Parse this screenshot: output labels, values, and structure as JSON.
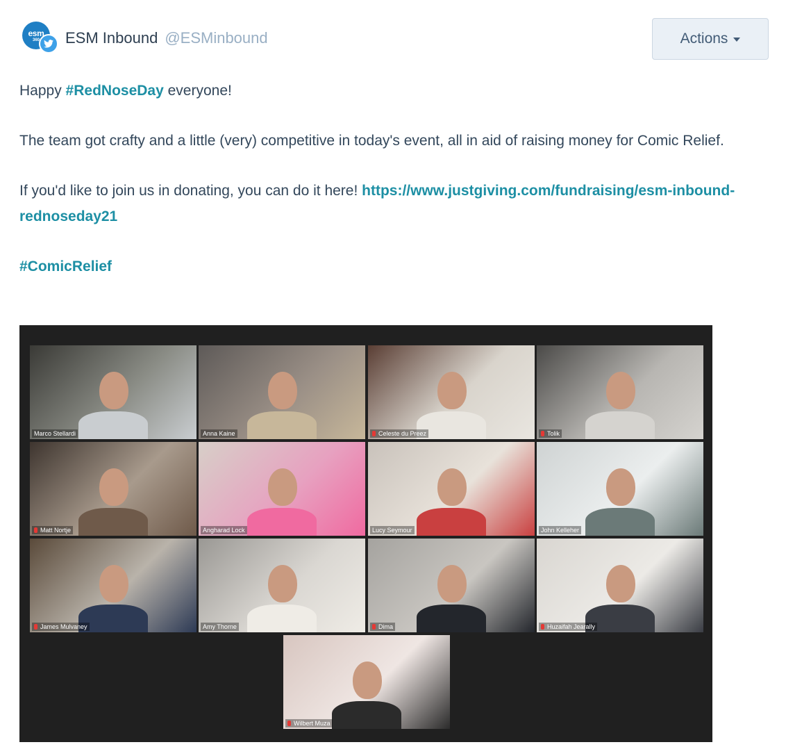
{
  "account": {
    "name": "ESM Inbound",
    "handle": "@ESMinbound",
    "avatar_text": "esm",
    "avatar_subtext": "360",
    "network_icon": "twitter-icon",
    "brand_color": "#1f7fc4",
    "twitter_color": "#3ea1e8"
  },
  "actions": {
    "label": "Actions"
  },
  "post": {
    "line1_prefix": "Happy ",
    "line1_hashtag": "#RedNoseDay",
    "line1_suffix": " everyone!",
    "paragraph2": "The team got crafty and a little (very) competitive in today's event, all in aid of raising money for Comic Relief.",
    "paragraph3_prefix": "If you'd like to join us in donating, you can do it here! ",
    "paragraph3_link": "https://www.justgiving.com/fundraising/esm-inbound-rednoseday21",
    "hashtag_footer": "#ComicRelief",
    "link_color": "#1d8fa4"
  },
  "video_call": {
    "participants": [
      {
        "name": "Marco Stellardi",
        "muted": false,
        "active": false
      },
      {
        "name": "Anna Kaine",
        "muted": false,
        "active": false
      },
      {
        "name": "Celeste du Preez",
        "muted": true,
        "active": false
      },
      {
        "name": "Tolik",
        "muted": true,
        "active": false
      },
      {
        "name": "Matt Nortje",
        "muted": true,
        "active": false
      },
      {
        "name": "Angharad Lock",
        "muted": false,
        "active": true
      },
      {
        "name": "Lucy Seymour",
        "muted": false,
        "active": false
      },
      {
        "name": "John Kelleher",
        "muted": false,
        "active": false
      },
      {
        "name": "James Mulvaney",
        "muted": true,
        "active": false
      },
      {
        "name": "Amy Thorne",
        "muted": false,
        "active": false
      },
      {
        "name": "Dima",
        "muted": true,
        "active": false
      },
      {
        "name": "Huzaifah Jearally",
        "muted": true,
        "active": false
      },
      {
        "name": "Wilbert Muza",
        "muted": true,
        "active": false
      }
    ]
  }
}
